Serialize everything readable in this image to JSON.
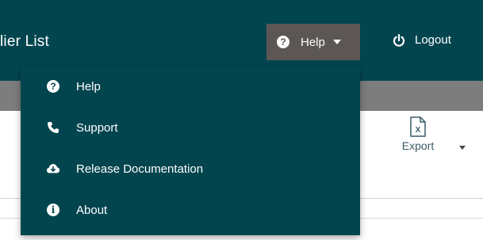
{
  "header": {
    "title": "lier List",
    "help_label": "Help",
    "logout_label": "Logout"
  },
  "toolbar": {
    "export_label": "Export"
  },
  "help_menu": {
    "items": [
      {
        "label": "Help",
        "icon": "question-circle-icon"
      },
      {
        "label": "Support",
        "icon": "phone-icon"
      },
      {
        "label": "Release Documentation",
        "icon": "cloud-download-icon"
      },
      {
        "label": "About",
        "icon": "info-circle-icon"
      }
    ]
  },
  "colors": {
    "header_bg": "#03454f",
    "help_button_bg": "#5c5655",
    "secondary_bar": "#7d7d7d",
    "export_text": "#3b5c68"
  }
}
